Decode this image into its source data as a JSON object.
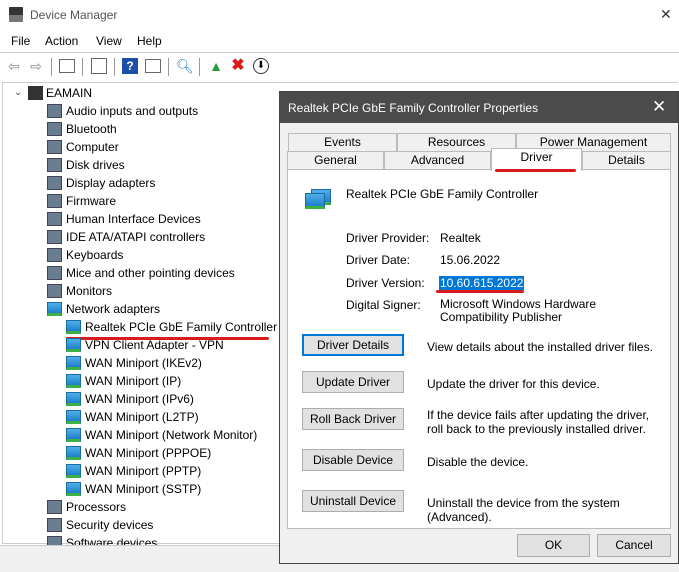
{
  "window": {
    "title": "Device Manager",
    "menu": [
      "File",
      "Action",
      "View",
      "Help"
    ],
    "toolbar_icons": [
      "back-icon",
      "forward-icon",
      "show-hide-console-tree-icon",
      "properties-icon",
      "help-icon",
      "action-pane-icon",
      "scan-hardware-icon",
      "update-driver-icon",
      "uninstall-icon",
      "disable-icon"
    ]
  },
  "tree": {
    "root": "EAMAIN",
    "categories": [
      "Audio inputs and outputs",
      "Bluetooth",
      "Computer",
      "Disk drives",
      "Display adapters",
      "Firmware",
      "Human Interface Devices",
      "IDE ATA/ATAPI controllers",
      "Keyboards",
      "Mice and other pointing devices",
      "Monitors",
      "Network adapters"
    ],
    "network_children": [
      "Realtek PCIe GbE Family Controller",
      "VPN Client Adapter - VPN",
      "WAN Miniport (IKEv2)",
      "WAN Miniport (IP)",
      "WAN Miniport (IPv6)",
      "WAN Miniport (L2TP)",
      "WAN Miniport (Network Monitor)",
      "WAN Miniport (PPPOE)",
      "WAN Miniport (PPTP)",
      "WAN Miniport (SSTP)"
    ],
    "after": [
      "Processors",
      "Security devices",
      "Software devices"
    ]
  },
  "dialog": {
    "title": "Realtek PCIe GbE Family Controller Properties",
    "tabs_row1": [
      "Events",
      "Resources",
      "Power Management"
    ],
    "tabs_row2": [
      "General",
      "Advanced",
      "Driver",
      "Details"
    ],
    "active_tab": "Driver",
    "device_name": "Realtek PCIe GbE Family Controller",
    "fields": [
      {
        "label": "Driver Provider:",
        "value": "Realtek"
      },
      {
        "label": "Driver Date:",
        "value": "15.06.2022"
      },
      {
        "label": "Driver Version:",
        "value": "10.60.615.2022"
      },
      {
        "label": "Digital Signer:",
        "value": "Microsoft Windows Hardware Compatibility Publisher"
      }
    ],
    "actions": [
      {
        "button": "Driver Details",
        "desc": "View details about the installed driver files."
      },
      {
        "button": "Update Driver",
        "desc": "Update the driver for this device."
      },
      {
        "button": "Roll Back Driver",
        "desc": "If the device fails after updating the driver, roll back to the previously installed driver."
      },
      {
        "button": "Disable Device",
        "desc": "Disable the device."
      },
      {
        "button": "Uninstall Device",
        "desc": "Uninstall the device from the system (Advanced)."
      }
    ],
    "ok": "OK",
    "cancel": "Cancel"
  },
  "colors": {
    "highlight": "#0078d7",
    "annotation": "#d81c1c",
    "dialog_title_bg": "#4b4b4b"
  }
}
